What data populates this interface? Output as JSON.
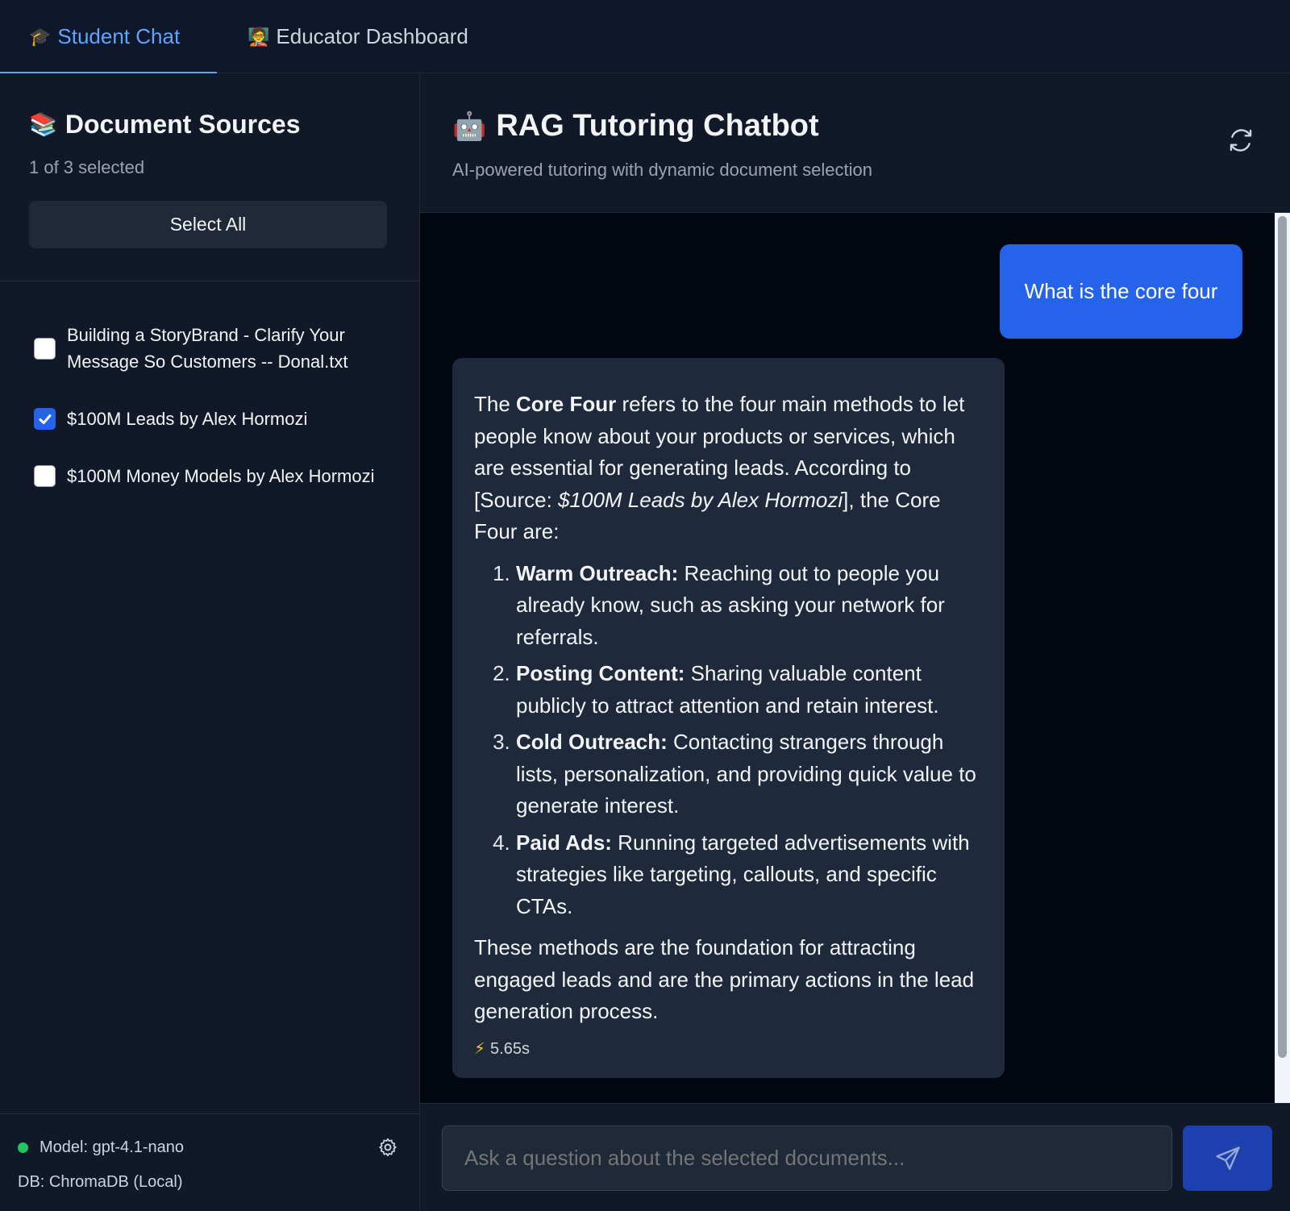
{
  "tabs": [
    {
      "emoji": "🎓",
      "label": "Student Chat",
      "active": true
    },
    {
      "emoji": "🧑‍🏫",
      "label": "Educator Dashboard",
      "active": false
    }
  ],
  "sidebar": {
    "title_emoji": "📚",
    "title": "Document Sources",
    "count": "1 of 3 selected",
    "select_all": "Select All",
    "documents": [
      {
        "label": "Building a StoryBrand - Clarify Your Message So Customers -- Donal.txt",
        "checked": false
      },
      {
        "label": "$100M Leads by Alex Hormozi",
        "checked": true
      },
      {
        "label": "$100M Money Models by Alex Hormozi",
        "checked": false
      }
    ],
    "footer": {
      "model": "Model: gpt-4.1-nano",
      "db": "DB: ChromaDB (Local)",
      "status_color": "#22c55e"
    }
  },
  "main": {
    "title_emoji": "🤖",
    "title": "RAG Tutoring Chatbot",
    "subtitle": "AI-powered tutoring with dynamic document selection"
  },
  "messages": {
    "user": "What is the core four",
    "bot": {
      "intro_1": "The ",
      "intro_bold": "Core Four",
      "intro_2": " refers to the four main methods to let people know about your products or services, which are essential for generating leads. According to [Source: ",
      "intro_italic": "$100M Leads by Alex Hormozi",
      "intro_3": "], the Core Four are:",
      "items": [
        {
          "title": "Warm Outreach:",
          "text": " Reaching out to people you already know, such as asking your network for referrals."
        },
        {
          "title": "Posting Content:",
          "text": " Sharing valuable content publicly to attract attention and retain interest."
        },
        {
          "title": "Cold Outreach:",
          "text": " Contacting strangers through lists, personalization, and providing quick value to generate interest."
        },
        {
          "title": "Paid Ads:",
          "text": " Running targeted advertisements with strategies like targeting, callouts, and specific CTAs."
        }
      ],
      "outro": "These methods are the foundation for attracting engaged leads and are the primary actions in the lead generation process.",
      "timing": "5.65s"
    }
  },
  "input": {
    "placeholder": "Ask a question about the selected documents..."
  },
  "colors": {
    "accent": "#60a5fa",
    "user_bubble": "#2563eb",
    "bot_bubble": "#1e293b",
    "send_button": "#1e40af"
  }
}
